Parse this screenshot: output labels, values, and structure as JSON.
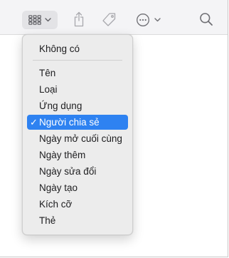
{
  "toolbar": {
    "view_button_icon": "grid-icon",
    "share_icon": "share-icon",
    "tag_icon": "tag-icon",
    "action_icon": "ellipsis-circle-icon",
    "search_icon": "search-icon"
  },
  "menu": {
    "top_item": "Không có",
    "items": [
      "Tên",
      "Loại",
      "Ứng dụng",
      "Người chia sẻ",
      "Ngày mở cuối cùng",
      "Ngày thêm",
      "Ngày sửa đổi",
      "Ngày tạo",
      "Kích cỡ",
      "Thẻ"
    ],
    "selected": "Người chia sẻ",
    "check_glyph": "✓"
  },
  "colors": {
    "selection": "#2e82f1",
    "menu_bg": "#ececec",
    "toolbar_bg": "#f4f4f6"
  }
}
